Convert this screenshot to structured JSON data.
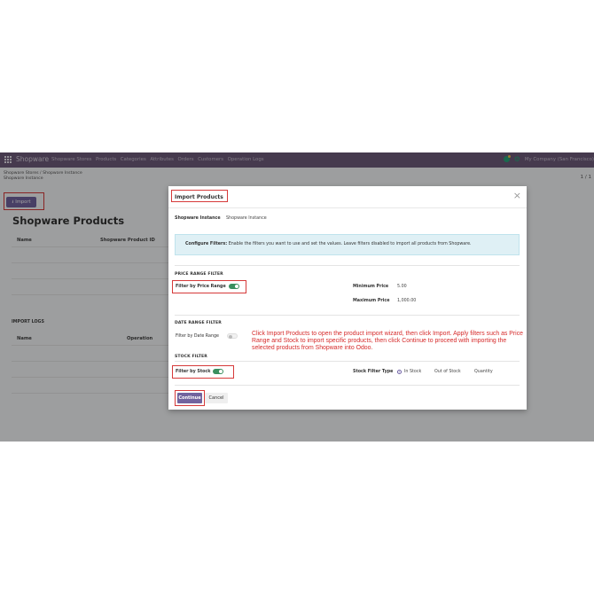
{
  "navbar": {
    "brand": "Shopware",
    "menu": [
      "Shopware Stores",
      "Products",
      "Categories",
      "Attributes",
      "Orders",
      "Customers",
      "Operation Logs"
    ],
    "company": "My Company (San Francisco)"
  },
  "breadcrumb": {
    "parent": "Shopware Stores",
    "separator": "/",
    "current": "Shopware Instance",
    "sub": "Shopware Instance"
  },
  "pager": "1 / 1",
  "import_button": {
    "icon": "upload-icon",
    "label": "Import"
  },
  "list": {
    "title": "Shopware Products",
    "columns": [
      "Name",
      "Shopware Product ID"
    ],
    "logs_title": "IMPORT LOGS",
    "logs_columns": [
      "Name",
      "Operation"
    ]
  },
  "modal": {
    "title": "Import Products",
    "close": "×",
    "instance_label": "Shopware Instance",
    "instance_value": "Shopware Instance",
    "info_bold": "Configure Filters:",
    "info_text": " Enable the filters you want to use and set the values. Leave filters disabled to import all products from Shopware.",
    "price": {
      "section": "PRICE RANGE FILTER",
      "filter_label": "Filter by Price Range",
      "enabled": true,
      "min_label": "Minimum Price",
      "min_value": "5.00",
      "max_label": "Maximum Price",
      "max_value": "1,000.00"
    },
    "date": {
      "section": "DATE RANGE FILTER",
      "filter_label": "Filter by Date Range",
      "enabled": false
    },
    "stock": {
      "section": "STOCK FILTER",
      "filter_label": "Filter by Stock",
      "enabled": true,
      "type_label": "Stock Filter Type",
      "options": [
        "In Stock",
        "Out of Stock",
        "Quantity"
      ],
      "selected": "In Stock"
    },
    "continue_label": "Continue",
    "cancel_label": "Cancel"
  },
  "callout": "Click Import Products to open the product import wizard, then click Import. Apply filters such as Price Range and Stock to import specific products, then click Continue to proceed with importing the selected products from Shopware into Odoo.",
  "colors": {
    "navbar": "#6e5b7b",
    "primary": "#71639e",
    "highlight": "#d63a3a",
    "toggle_on": "#3a8f5f",
    "info_bg": "#dff0f5"
  }
}
